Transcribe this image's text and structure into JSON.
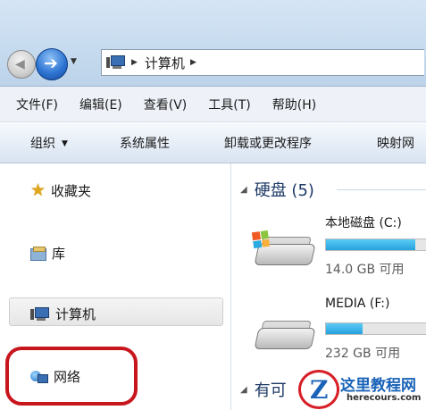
{
  "address_bar": {
    "breadcrumb": [
      "计算机"
    ]
  },
  "menu_bar": {
    "items": [
      "文件(F)",
      "编辑(E)",
      "查看(V)",
      "工具(T)",
      "帮助(H)"
    ]
  },
  "command_bar": {
    "organize": "组织",
    "system_properties": "系统属性",
    "uninstall": "卸载或更改程序",
    "map_network": "映射网"
  },
  "nav_pane": {
    "favorites": "收藏夹",
    "libraries": "库",
    "computer": "计算机",
    "network": "网络"
  },
  "content": {
    "hard_disks_group": "硬盘 (5)",
    "removable_group": "有可",
    "drives": [
      {
        "name": "本地磁盘 (C:)",
        "free_text": "14.0 GB 可用",
        "used_fraction": 0.85
      },
      {
        "name": "MEDIA (F:)",
        "free_text": "232 GB 可用",
        "used_fraction": 0.35
      }
    ]
  },
  "watermark": {
    "title": "这里教程网",
    "url": "herecours.com",
    "logo_letter": "Z"
  },
  "colors": {
    "highlight_ring": "#c8161d",
    "drive_bar_fill": "#25a2dc",
    "group_heading": "#1e3a66"
  }
}
